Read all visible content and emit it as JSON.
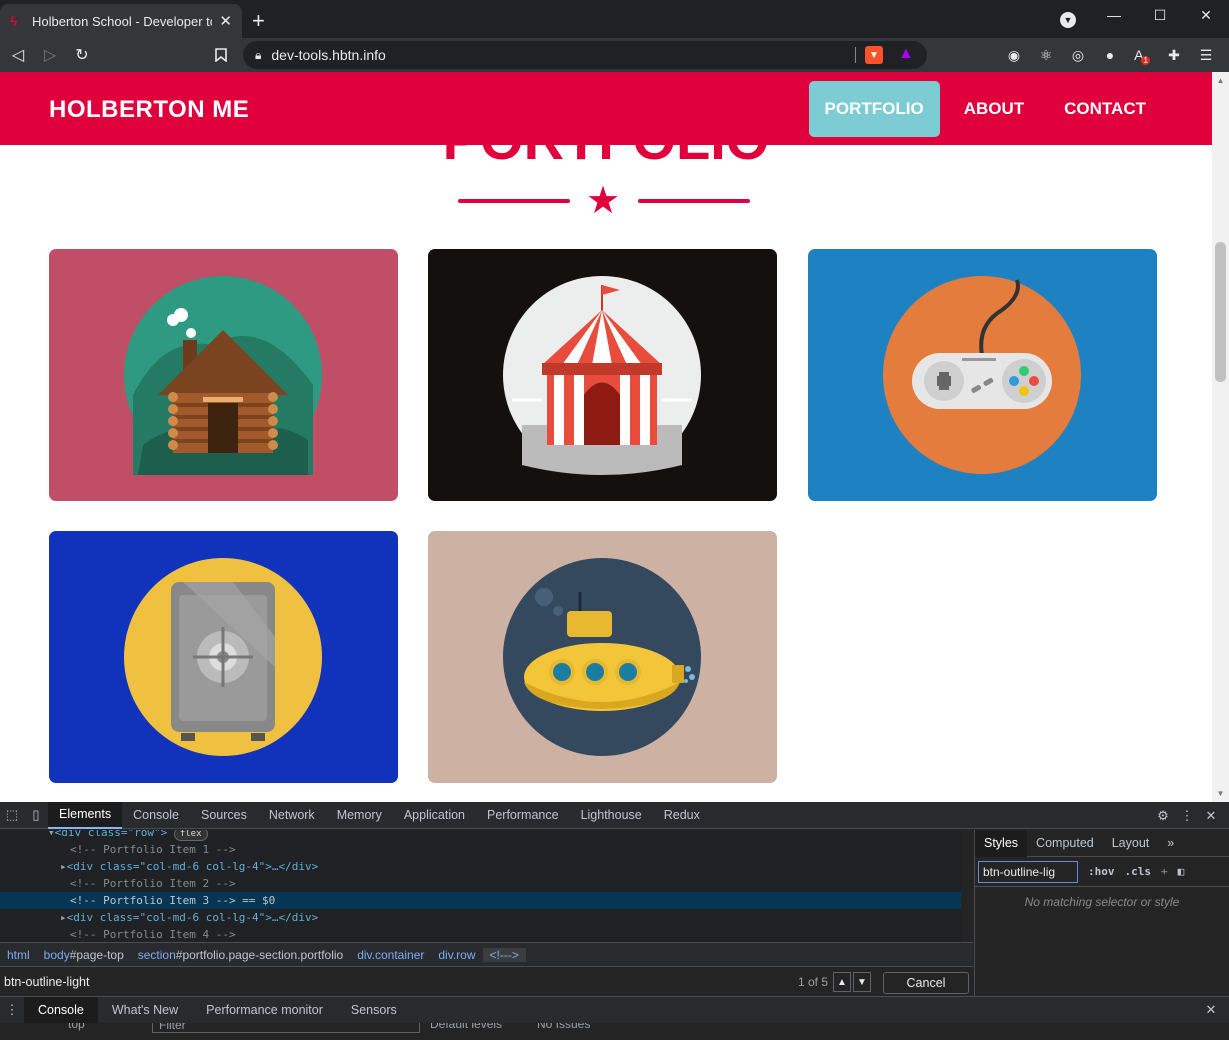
{
  "browser": {
    "tab_title": "Holberton School - Developer too",
    "tab_favicon": "ϟ",
    "url": "dev-tools.hbtn.info",
    "extension_badge": "1"
  },
  "site": {
    "brand": "HOLBERTON ME",
    "nav": [
      {
        "label": "PORTFOLIO",
        "active": true
      },
      {
        "label": "ABOUT",
        "active": false
      },
      {
        "label": "CONTACT",
        "active": false
      }
    ],
    "section_title": "PORTFOLIO",
    "portfolio_items": [
      {
        "subject": "cabin",
        "color": "#bf4e66"
      },
      {
        "subject": "circus tent",
        "color": "#151010"
      },
      {
        "subject": "game controller",
        "color": "#1e82c2"
      },
      {
        "subject": "safe",
        "color": "#1133bb"
      },
      {
        "subject": "submarine",
        "color": "#cdb2a3"
      }
    ],
    "accent": "#e0003c",
    "active_nav_color": "#7dcbd3"
  },
  "devtools": {
    "tabs": [
      "Elements",
      "Console",
      "Sources",
      "Network",
      "Memory",
      "Application",
      "Performance",
      "Lighthouse",
      "Redux"
    ],
    "active_tab": "Elements",
    "dom_lines": {
      "row_tag": "<div class=\"row\">",
      "flex_badge": "flex",
      "c1": "<!-- Portfolio Item 1 -->",
      "col1": "<div class=\"col-md-6 col-lg-4\">…</div>",
      "c2": "<!-- Portfolio Item 2 -->",
      "c3": "<!-- Portfolio Item 3 --> == $0",
      "col2": "<div class=\"col-md-6 col-lg-4\">…</div>",
      "c4": "<!-- Portfolio Item 4 -->"
    },
    "breadcrumbs": {
      "html": "html",
      "body_tag": "body",
      "body_id": "#page-top",
      "section_tag": "section",
      "section_id": "#portfolio.page-section.portfolio",
      "container": "div.container",
      "row": "div.row",
      "comment": "<!--->"
    },
    "search": {
      "value": "btn-outline-light",
      "count": "1 of 5",
      "cancel_label": "Cancel"
    },
    "styles_tabs": [
      "Styles",
      "Computed",
      "Layout"
    ],
    "styles_more": "»",
    "styles_filter": "btn-outline-lig",
    "hov": ":hov",
    "cls": ".cls",
    "no_match": "No matching selector or style",
    "drawer_tabs": [
      "Console",
      "What's New",
      "Performance monitor",
      "Sensors"
    ],
    "console_bar": {
      "context": "top",
      "filter_placeholder": "Filter",
      "levels": "Default levels",
      "issues": "No Issues"
    }
  }
}
